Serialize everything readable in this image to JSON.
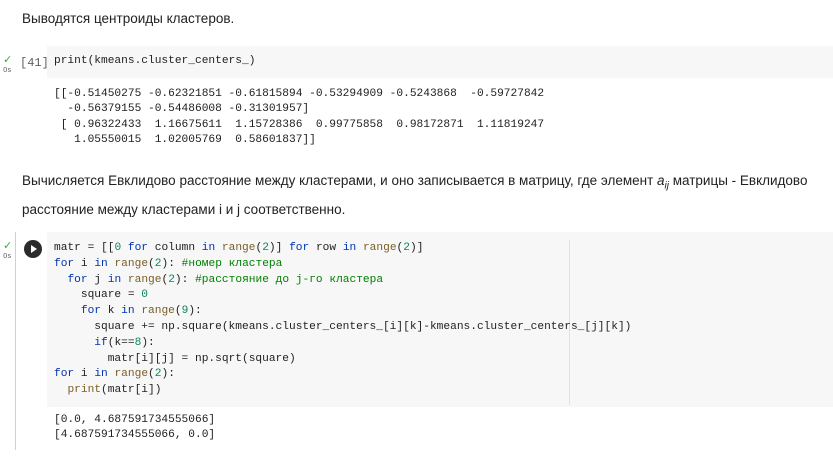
{
  "text_cell_1": "Выводятся центроиды кластеров.",
  "cell_41": {
    "status_check": "✓",
    "status_time": "0s",
    "exec_count": "[41]",
    "code": "print(kmeans.cluster_centers_)",
    "output": "[[-0.51450275 -0.62321851 -0.61815894 -0.53294909 -0.5243868  -0.59727842\n  -0.56379155 -0.54486008 -0.31301957]\n [ 0.96322433  1.16675611  1.15728386  0.99775858  0.98172871  1.11819247\n   1.05550015  1.02005769  0.58601837]]"
  },
  "text_cell_2": {
    "before": "Вычисляется Евклидово расстояние между кластерами, и оно записывается в матрицу, где элемент ",
    "var_a": "a",
    "var_sub": "ij",
    "after": " матрицы - Евклидово расстояние между кластерами i и j соответственно."
  },
  "cell_42": {
    "status_check": "✓",
    "status_time": "0s",
    "run_button": "run-cell",
    "output": "[0.0, 4.687591734555066]\n[4.687591734555066, 0.0]"
  }
}
